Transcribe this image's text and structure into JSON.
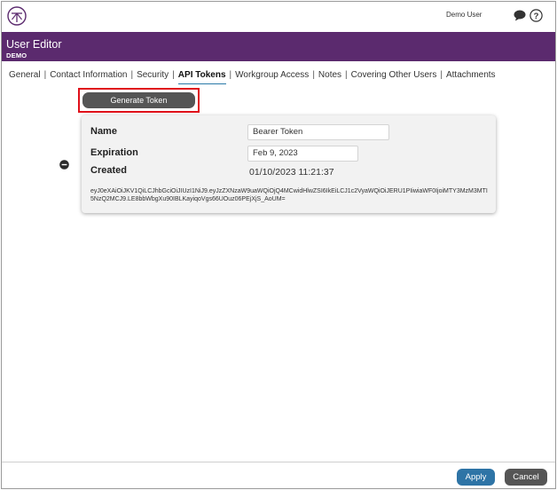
{
  "topbar": {
    "user_name": "Demo User",
    "icons": [
      "logo-icon",
      "chat-icon",
      "help-icon"
    ]
  },
  "header": {
    "title": "User Editor",
    "subtitle": "DEMO",
    "background_color": "#5b2a6e"
  },
  "tabs": [
    {
      "label": "General",
      "active": false
    },
    {
      "label": "Contact Information",
      "active": false
    },
    {
      "label": "Security",
      "active": false
    },
    {
      "label": "API Tokens",
      "active": true
    },
    {
      "label": "Workgroup Access",
      "active": false
    },
    {
      "label": "Notes",
      "active": false
    },
    {
      "label": "Covering Other Users",
      "active": false
    },
    {
      "label": "Attachments",
      "active": false
    }
  ],
  "tab_separator": "|",
  "generate_token": {
    "label": "Generate Token",
    "highlight_color": "#e0101a"
  },
  "token_card": {
    "name_label": "Name",
    "name_value": "Bearer Token",
    "expiration_label": "Expiration",
    "expiration_value": "Feb 9, 2023",
    "created_label": "Created",
    "created_value": "01/10/2023 11:21:37",
    "token": "eyJ0eXAiOiJKV1QiLCJhbGciOiJIUzI1NiJ9.eyJzZXNzaW9uaWQiOjQ4MCwidHlwZSI6IkEiLCJ1c2VyaWQiOiJERU1PIiwiaWF0IjoiMTY3MzM3MTI5NzQ2MCJ9.LE8bbWbgXu90IBLKayiqoVgs66UOuz06PEjXjS_AoUM="
  },
  "footer": {
    "apply_label": "Apply",
    "cancel_label": "Cancel",
    "apply_color": "#2e74a6"
  }
}
